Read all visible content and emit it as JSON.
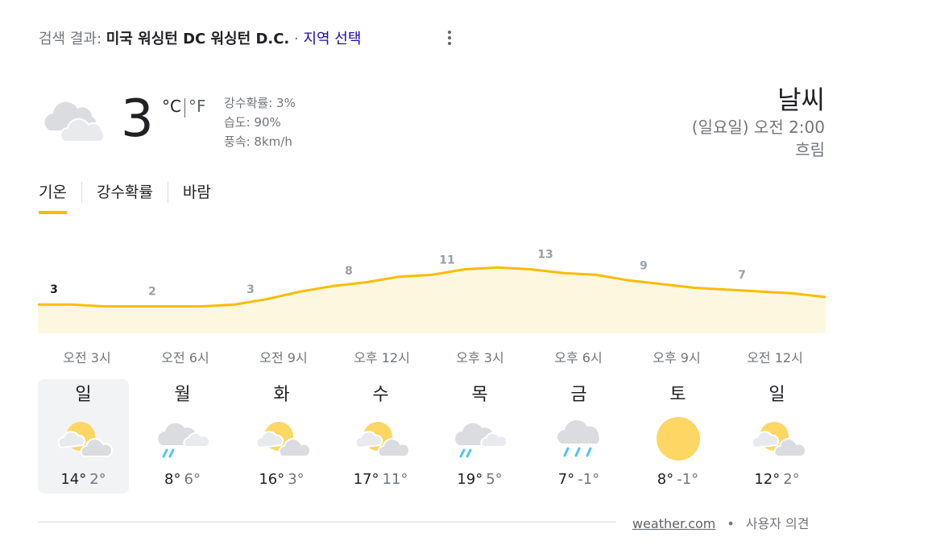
{
  "header": {
    "prefix": "검색 결과: ",
    "location": "미국 워싱턴 DC 워싱턴 D.C.",
    "separator": " · ",
    "choose_region": "지역 선택"
  },
  "current": {
    "icon": "cloudy-icon",
    "temperature": "3",
    "unit_c": "°C",
    "unit_f": "°F",
    "precip": "강수확률: 3%",
    "humidity": "습도: 90%",
    "wind": "풍속: 8km/h"
  },
  "summary": {
    "title": "날씨",
    "datetime": "(일요일) 오전 2:00",
    "condition": "흐림"
  },
  "tabs": [
    "기온",
    "강수확률",
    "바람"
  ],
  "chart_data": {
    "type": "area",
    "x": [
      "오전 3시",
      "오전 6시",
      "오전 9시",
      "오후 12시",
      "오후 3시",
      "오후 6시",
      "오후 9시",
      "오전 12시"
    ],
    "labels": [
      3,
      2,
      3,
      8,
      11,
      13,
      9,
      7
    ],
    "series": [
      {
        "values": [
          3,
          3,
          2.5,
          2.5,
          2.5,
          2.5,
          3,
          4.5,
          6.5,
          8,
          9,
          10.5,
          11,
          12.5,
          13,
          12.5,
          11.5,
          11,
          9.5,
          8.5,
          7.5,
          7,
          6.5,
          6,
          5
        ]
      }
    ],
    "color": "#fbbc04",
    "fill": "#fef7e0"
  },
  "forecast": [
    {
      "day": "일",
      "icon": "partly-cloudy-icon",
      "high": "14°",
      "low": "2°"
    },
    {
      "day": "월",
      "icon": "rain-cloud-icon",
      "high": "8°",
      "low": "6°"
    },
    {
      "day": "화",
      "icon": "partly-cloudy-icon",
      "high": "16°",
      "low": "3°"
    },
    {
      "day": "수",
      "icon": "partly-cloudy-icon",
      "high": "17°",
      "low": "11°"
    },
    {
      "day": "목",
      "icon": "rain-cloud-icon",
      "high": "19°",
      "low": "5°"
    },
    {
      "day": "금",
      "icon": "showers-icon",
      "high": "7°",
      "low": "-1°"
    },
    {
      "day": "토",
      "icon": "sunny-icon",
      "high": "8°",
      "low": "-1°"
    },
    {
      "day": "일",
      "icon": "partly-cloudy-icon",
      "high": "12°",
      "low": "2°"
    }
  ],
  "footer": {
    "source": "weather.com",
    "dot": "•",
    "feedback": "사용자 의견"
  }
}
